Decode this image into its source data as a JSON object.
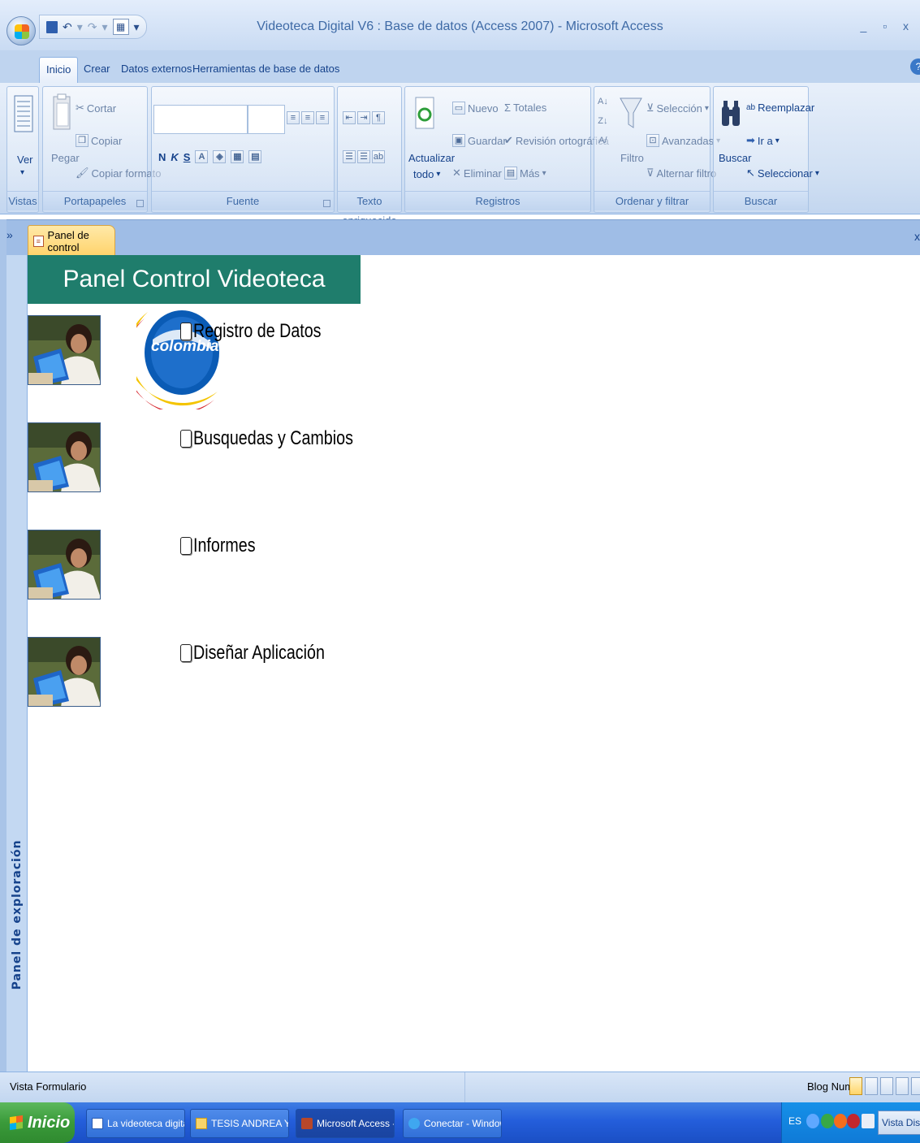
{
  "window": {
    "title": "Videoteca Digital V6 : Base de datos (Access 2007) - Microsoft Access",
    "controls": "_ ▫ x"
  },
  "ribbon_tabs": [
    "Inicio",
    "Crear",
    "Datos externos",
    "Herramientas de base de datos"
  ],
  "ribbon": {
    "vistas": {
      "title": "Vistas",
      "ver": "Ver"
    },
    "portapapeles": {
      "title": "Portapapeles",
      "pegar": "Pegar",
      "cortar": "Cortar",
      "copiar": "Copiar",
      "copiar_formato": "Copiar formato"
    },
    "fuente": {
      "title": "Fuente",
      "bold": "N",
      "italic": "K",
      "underline": "S"
    },
    "texto": {
      "title": "Texto enriquecido"
    },
    "registros": {
      "title": "Registros",
      "actualizar": "Actualizar",
      "todo": "todo",
      "nuevo": "Nuevo",
      "guardar": "Guardar",
      "eliminar": "Eliminar",
      "totales": "Totales",
      "revision": "Revisión ortográfica",
      "mas": "Más"
    },
    "ordenar": {
      "title": "Ordenar y filtrar",
      "filtro": "Filtro",
      "seleccion": "Selección",
      "avanzadas": "Avanzadas",
      "alternar": "Alternar filtro"
    },
    "buscar": {
      "title": "Buscar",
      "buscar": "Buscar",
      "reemplazar": "Reemplazar",
      "ir_a": "Ir a",
      "seleccionar": "Seleccionar"
    }
  },
  "document": {
    "tab_label": "Panel de control"
  },
  "nav_pane": {
    "label": "Panel de exploración"
  },
  "form": {
    "header": "Panel Control Videoteca",
    "logo_text": "colombia",
    "items": [
      "Registro de Datos",
      "Busquedas y Cambios",
      "Informes",
      "Diseñar Aplicación"
    ]
  },
  "statusbar": {
    "left": "Vista Formulario",
    "right": "Blog Num"
  },
  "taskbar": {
    "start": "Inicio",
    "tasks": [
      "La videoteca digital ...",
      "TESIS ANDREA Y VAN...",
      "Microsoft Access - Vid...",
      "Conectar - Windows I..."
    ],
    "lang": "ES",
    "tray_button": "Vista Diseño"
  },
  "colors": {
    "header_bg": "#1f7d6c",
    "doc_tab": "#ffd36b",
    "taskbar": "#245edb",
    "ribbon_text": "#15428b"
  }
}
